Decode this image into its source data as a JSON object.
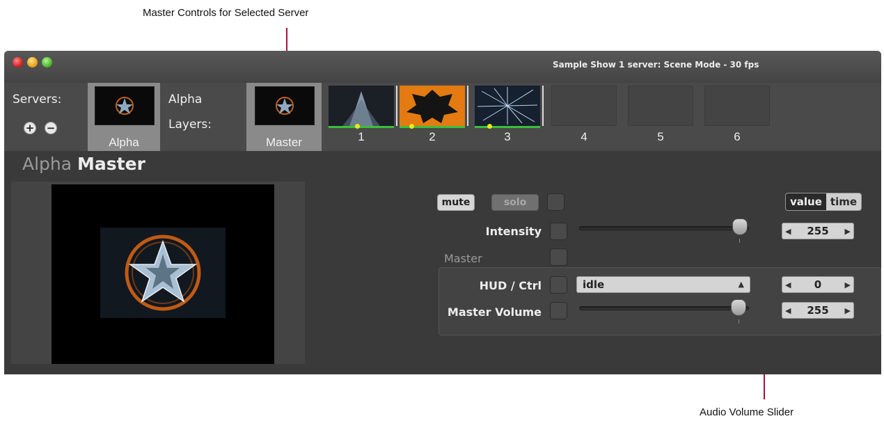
{
  "callouts": {
    "top": "Master Controls for Selected Server",
    "bottom": "Audio Volume Slider",
    "line_color": "#a4143c"
  },
  "window": {
    "title": "Sample Show 1 server: Scene Mode - 30 fps"
  },
  "toolbar": {
    "servers_label": "Servers:",
    "add_icon": "plus-circle-icon",
    "remove_icon": "minus-circle-icon",
    "server_thumb_label": "Alpha",
    "server_name": "Alpha",
    "layers_label": "Layers:",
    "master_thumb_label": "Master",
    "layers": [
      {
        "num": "1"
      },
      {
        "num": "2"
      },
      {
        "num": "3"
      },
      {
        "num": "4"
      },
      {
        "num": "5"
      },
      {
        "num": "6"
      }
    ]
  },
  "main": {
    "heading_prefix": "Alpha",
    "heading_main": "Master",
    "mute_label": "mute",
    "solo_label": "solo",
    "mode_value": "value",
    "mode_time": "time",
    "intensity_label": "Intensity",
    "intensity_value": "255",
    "intensity_fraction": 1.0,
    "master_section_label": "Master",
    "hud_label": "HUD / Ctrl",
    "hud_select": "idle",
    "hud_value": "0",
    "volume_label": "Master Volume",
    "volume_value": "255",
    "volume_fraction": 1.0
  }
}
